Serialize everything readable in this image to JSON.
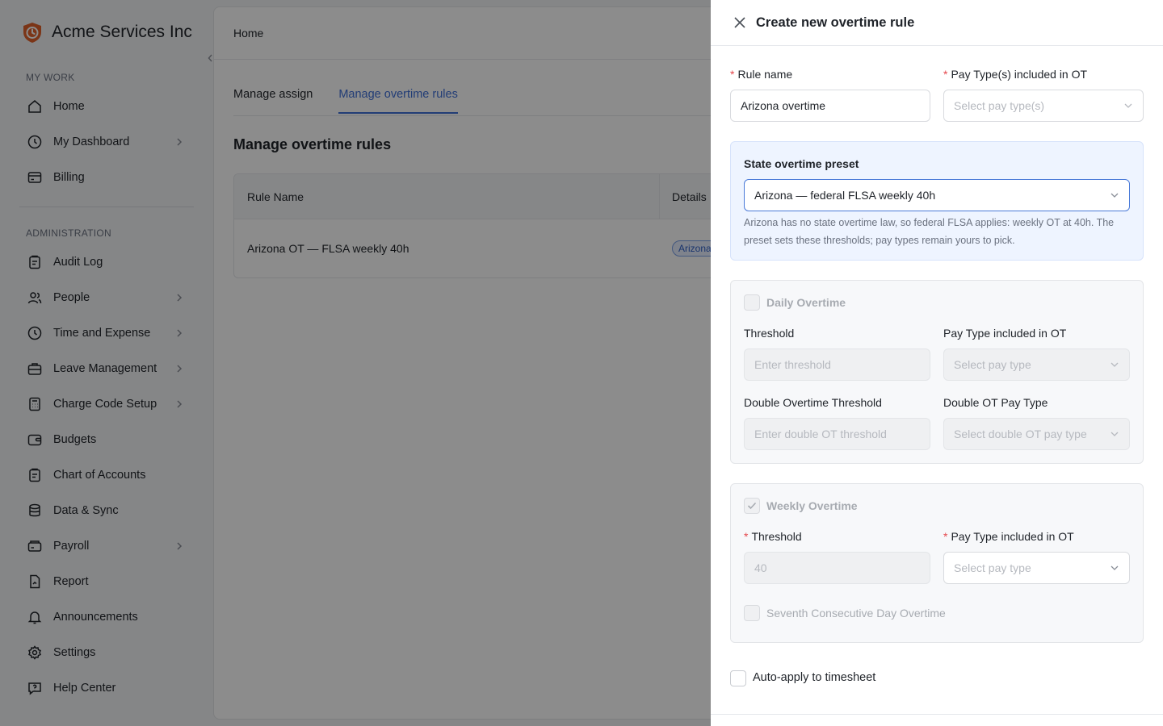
{
  "app": {
    "brand_name": "Acme Services Inc",
    "sidebar": {
      "section_my_work": "MY WORK",
      "section_admin": "ADMINISTRATION",
      "items": [
        {
          "label": "Home",
          "icon": "home-icon",
          "has_children": false
        },
        {
          "label": "My Dashboard",
          "icon": "clock-icon",
          "has_children": true
        },
        {
          "label": "Billing",
          "icon": "billing-icon",
          "has_children": false
        },
        {
          "label": "Audit Log",
          "icon": "clipboard-icon",
          "has_children": false
        },
        {
          "label": "People",
          "icon": "people-icon",
          "has_children": true
        },
        {
          "label": "Time and Expense",
          "icon": "clock-icon",
          "has_children": true
        },
        {
          "label": "Leave Management",
          "icon": "briefcase-icon",
          "has_children": true
        },
        {
          "label": "Charge Code Setup",
          "icon": "calculator-icon",
          "has_children": true
        },
        {
          "label": "Budgets",
          "icon": "wallet-icon",
          "has_children": false
        },
        {
          "label": "Chart of Accounts",
          "icon": "clipboard-icon",
          "has_children": false
        },
        {
          "label": "Data & Sync",
          "icon": "database-icon",
          "has_children": false
        },
        {
          "label": "Payroll",
          "icon": "payroll-icon",
          "has_children": true
        },
        {
          "label": "Report",
          "icon": "report-icon",
          "has_children": false
        },
        {
          "label": "Announcements",
          "icon": "bell-icon",
          "has_children": false
        },
        {
          "label": "Settings",
          "icon": "gear-icon",
          "has_children": false
        },
        {
          "label": "Help Center",
          "icon": "help-icon",
          "has_children": false
        }
      ]
    },
    "main": {
      "breadcrumb": "Home",
      "tabs": [
        {
          "label": "Manage assign",
          "active": false
        },
        {
          "label": "Manage overtime rules",
          "active": true
        }
      ],
      "page_title": "Manage overtime rules",
      "table": {
        "columns": [
          "Rule Name",
          "Details"
        ],
        "rows": [
          {
            "name": "Arizona OT — FLSA weekly 40h",
            "tag": "Arizona"
          }
        ]
      }
    }
  },
  "drawer": {
    "title": "Create new overtime rule",
    "rule_name_label": "Rule name",
    "rule_name_value": "Arizona overtime",
    "pay_types_label": "Pay Type(s) included in OT",
    "pay_types_placeholder": "Select pay type(s)",
    "preset": {
      "title": "State overtime preset",
      "selected": "Arizona — federal FLSA weekly 40h",
      "help": "Arizona has no state overtime law, so federal FLSA applies: weekly OT at 40h. The preset sets these thresholds; pay types remain yours to pick."
    },
    "daily": {
      "label": "Daily Overtime",
      "checked": false,
      "threshold_label": "Threshold",
      "threshold_placeholder": "Enter threshold",
      "pay_type_label": "Pay Type included in OT",
      "pay_type_placeholder": "Select pay type",
      "double_threshold_label": "Double Overtime Threshold",
      "double_threshold_placeholder": "Enter double OT threshold",
      "double_pay_type_label": "Double OT Pay Type",
      "double_pay_type_placeholder": "Select double OT pay type"
    },
    "weekly": {
      "label": "Weekly Overtime",
      "checked": true,
      "threshold_label": "Threshold",
      "threshold_value": "40",
      "pay_type_label": "Pay Type included in OT",
      "pay_type_placeholder": "Select pay type",
      "seventh_day_label": "Seventh Consecutive Day Overtime",
      "seventh_day_checked": false
    },
    "auto_apply_label": "Auto-apply to timesheet",
    "auto_apply_checked": false
  },
  "colors": {
    "accent": "#3f6fd8",
    "required": "#e5484d",
    "brand": "#e0622a",
    "overlay": "rgba(0,0,0,0.45)"
  }
}
